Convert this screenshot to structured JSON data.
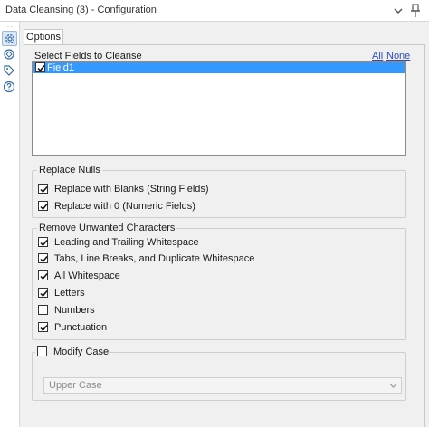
{
  "window": {
    "title": "Data Cleansing (3) - Configuration"
  },
  "rail": {
    "items": [
      {
        "icon": "gear-icon",
        "active": true
      },
      {
        "icon": "connection-icon",
        "active": false
      },
      {
        "icon": "tag-icon",
        "active": false
      },
      {
        "icon": "help-icon",
        "active": false
      }
    ]
  },
  "tabs": [
    {
      "label": "Options",
      "active": true
    }
  ],
  "fields": {
    "label": "Select Fields to Cleanse",
    "all_label": "All",
    "none_label": "None",
    "items": [
      {
        "label": "Field1",
        "checked": true,
        "selected": true
      }
    ]
  },
  "replace_nulls": {
    "title": "Replace Nulls",
    "options": [
      {
        "label": "Replace with Blanks (String Fields)",
        "checked": true
      },
      {
        "label": "Replace with 0 (Numeric Fields)",
        "checked": true
      }
    ]
  },
  "remove_chars": {
    "title": "Remove Unwanted Characters",
    "options": [
      {
        "label": "Leading and Trailing Whitespace",
        "checked": true
      },
      {
        "label": "Tabs, Line Breaks, and Duplicate Whitespace",
        "checked": true
      },
      {
        "label": "All Whitespace",
        "checked": true
      },
      {
        "label": "Letters",
        "checked": true
      },
      {
        "label": "Numbers",
        "checked": false
      },
      {
        "label": "Punctuation",
        "checked": true
      }
    ]
  },
  "modify_case": {
    "label": "Modify Case",
    "checked": false,
    "selected_value": "Upper Case"
  },
  "colors": {
    "selection": "#3399ff",
    "link": "#2a4cc5",
    "panel_bg": "#f0f0f0"
  }
}
